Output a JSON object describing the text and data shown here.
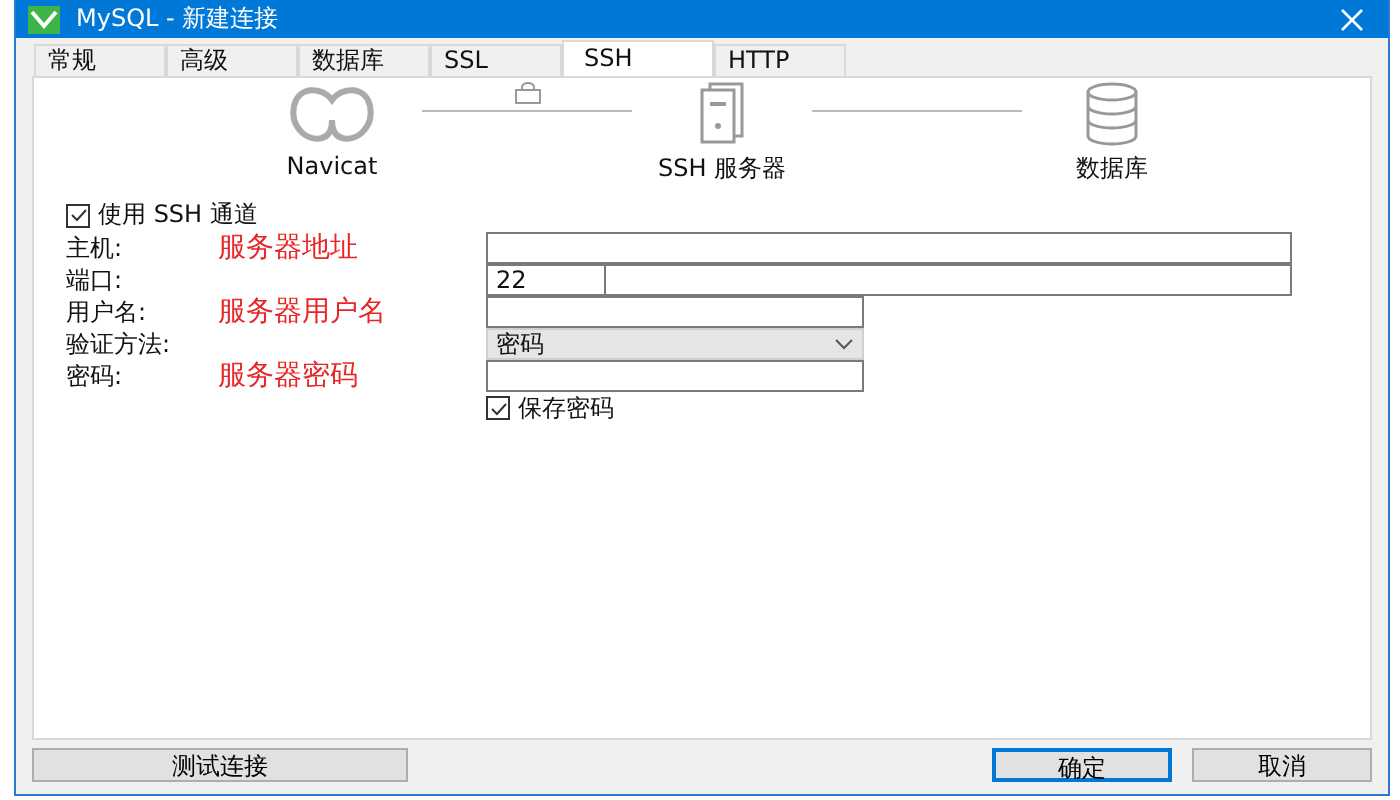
{
  "window": {
    "title": "MySQL - 新建连接"
  },
  "tabs": [
    {
      "label": "常规",
      "selected": false
    },
    {
      "label": "高级",
      "selected": false
    },
    {
      "label": "数据库",
      "selected": false
    },
    {
      "label": "SSL",
      "selected": false
    },
    {
      "label": "SSH",
      "selected": true
    },
    {
      "label": "HTTP",
      "selected": false
    }
  ],
  "diagram": {
    "nodes": [
      {
        "label": "Navicat",
        "kind": "app"
      },
      {
        "label": "SSH 服务器",
        "kind": "server"
      },
      {
        "label": "数据库",
        "kind": "database"
      }
    ]
  },
  "use_ssh": {
    "label": "使用 SSH 通道",
    "checked": true
  },
  "fields": [
    {
      "label": "主机:",
      "note": "服务器地址",
      "kind": "wide"
    },
    {
      "label": "端口:",
      "value": "22",
      "kind": "port"
    },
    {
      "label": "用户名:",
      "note": "服务器用户名",
      "kind": "text"
    },
    {
      "label": "验证方法:",
      "value": "密码",
      "kind": "select"
    },
    {
      "label": "密码:",
      "note": "服务器密码",
      "kind": "text"
    }
  ],
  "save_password": {
    "label": "保存密码",
    "checked": true
  },
  "buttons": [
    {
      "label": "测试连接",
      "default": false
    },
    {
      "label": "确定",
      "default": true
    },
    {
      "label": "取消",
      "default": false
    }
  ]
}
